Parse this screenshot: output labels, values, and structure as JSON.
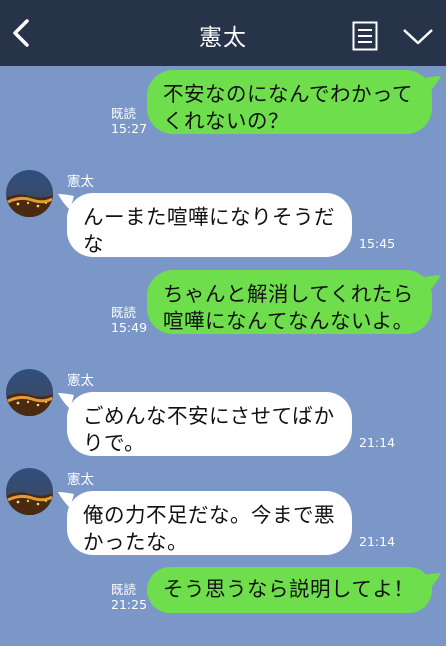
{
  "header": {
    "title": "憲太"
  },
  "messages": [
    {
      "side": "me",
      "lines": [
        "不安なのになんでわかって",
        "くれないの？"
      ],
      "read": "既読",
      "time": "15:27"
    },
    {
      "side": "them",
      "sender": "憲太",
      "lines": [
        "んーまた喧嘩になりそうだ",
        "な"
      ],
      "time": "15:45"
    },
    {
      "side": "me",
      "lines": [
        "ちゃんと解消してくれたら",
        "喧嘩になんてなんないよ。"
      ],
      "read": "既読",
      "time": "15:49"
    },
    {
      "side": "them",
      "sender": "憲太",
      "lines": [
        "ごめんな不安にさせてばか",
        "りで。"
      ],
      "time": "21:14"
    },
    {
      "side": "them",
      "sender": "憲太",
      "lines": [
        "俺の力不足だな。今まで悪",
        "かったな。"
      ],
      "time": "21:14"
    },
    {
      "side": "me",
      "lines": [
        "そう思うなら説明してよ！"
      ],
      "read": "既読",
      "time": "21:25"
    }
  ]
}
